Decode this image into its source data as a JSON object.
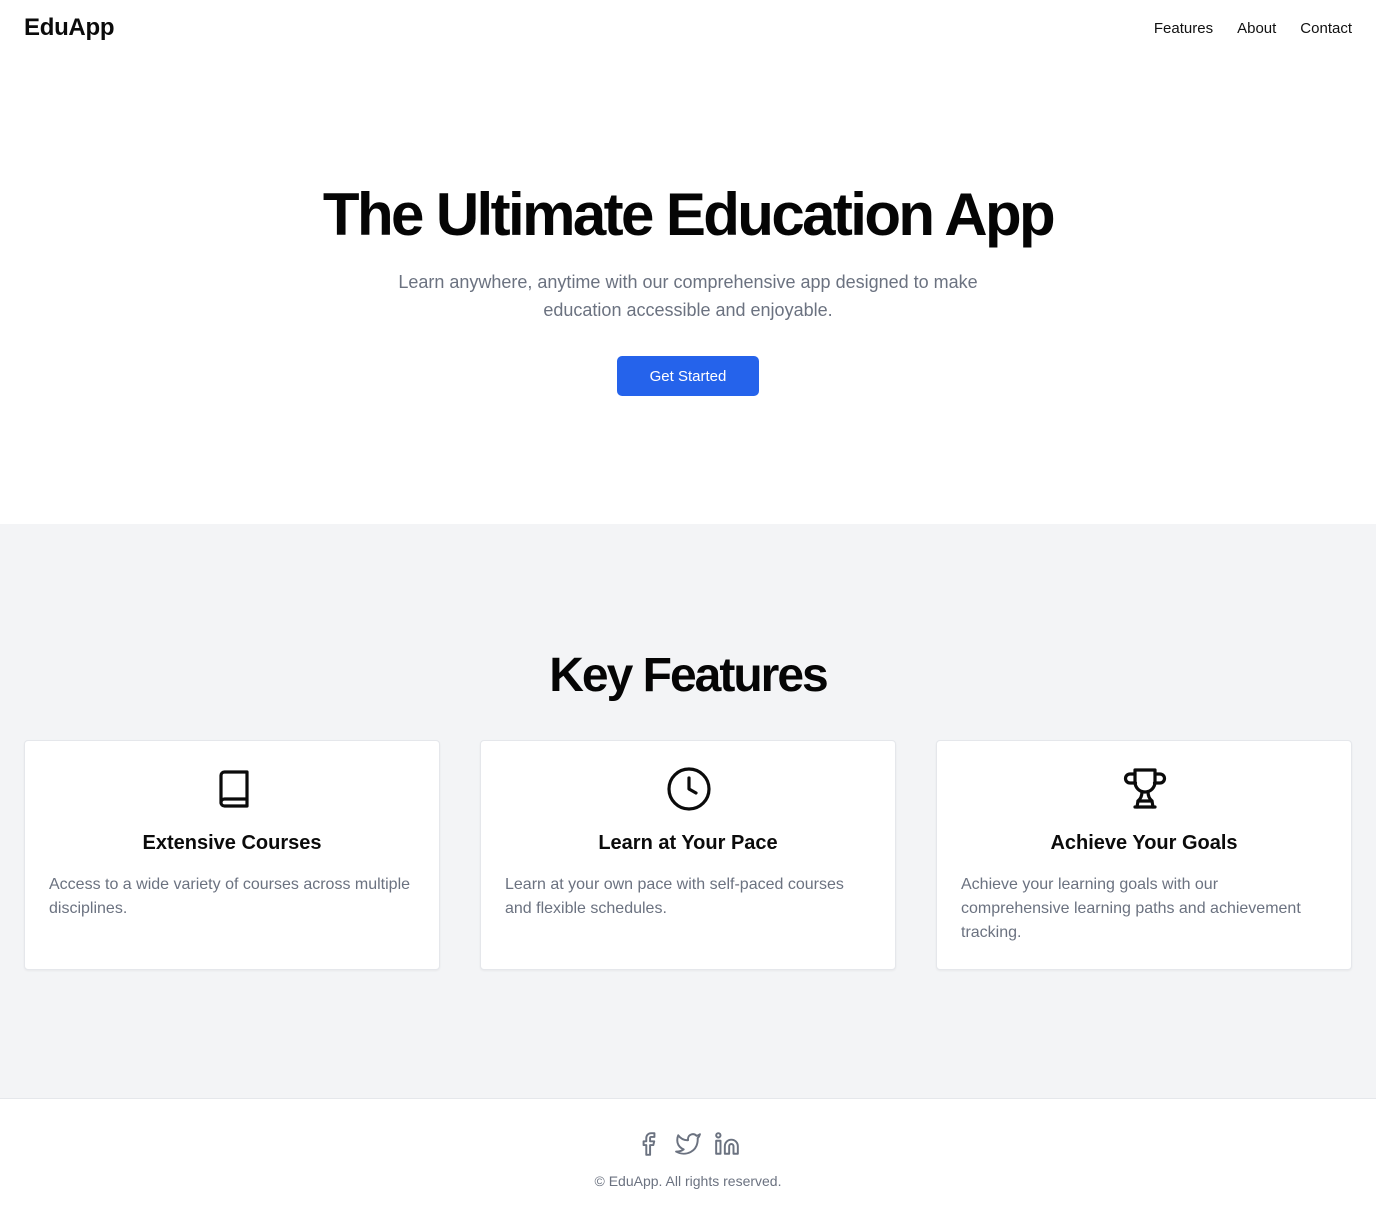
{
  "header": {
    "brand": "EduApp",
    "nav": [
      {
        "label": "Features"
      },
      {
        "label": "About"
      },
      {
        "label": "Contact"
      }
    ]
  },
  "hero": {
    "title": "The Ultimate Education App",
    "subtitle": "Learn anywhere, anytime with our comprehensive app designed to make education accessible and enjoyable.",
    "cta_label": "Get Started"
  },
  "features": {
    "title": "Key Features",
    "items": [
      {
        "icon": "book-icon",
        "title": "Extensive Courses",
        "description": "Access to a wide variety of courses across multiple disciplines."
      },
      {
        "icon": "clock-icon",
        "title": "Learn at Your Pace",
        "description": "Learn at your own pace with self-paced courses and flexible schedules."
      },
      {
        "icon": "trophy-icon",
        "title": "Achieve Your Goals",
        "description": "Achieve your learning goals with our comprehensive learning paths and achievement tracking."
      }
    ]
  },
  "footer": {
    "social": [
      {
        "icon": "facebook-icon"
      },
      {
        "icon": "twitter-icon"
      },
      {
        "icon": "linkedin-icon"
      }
    ],
    "copyright": "© EduApp. All rights reserved."
  },
  "colors": {
    "accent": "#2563eb",
    "muted_text": "#6b7280",
    "section_background": "#f3f4f6"
  }
}
